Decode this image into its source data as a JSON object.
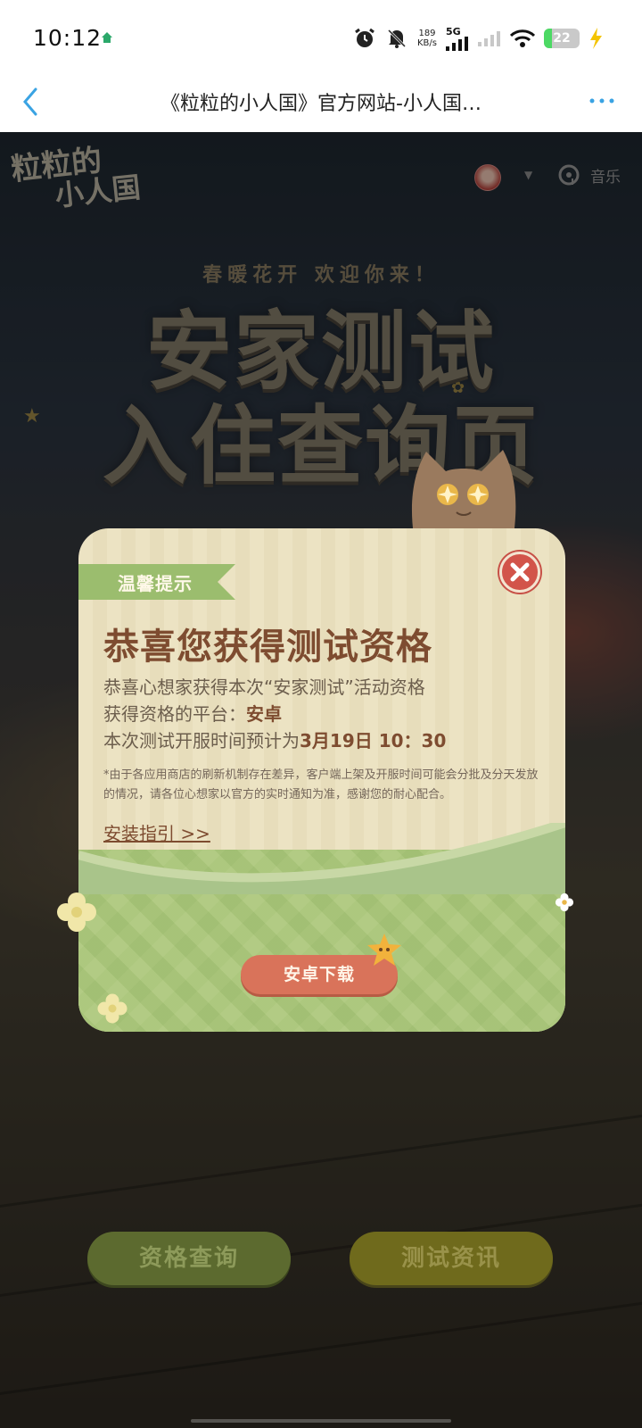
{
  "status_bar": {
    "time": "10:12",
    "net_speed_value": "189",
    "net_speed_unit": "KB/s",
    "network_type": "5G",
    "battery_level": "22"
  },
  "browser": {
    "page_title": "《粒粒的小人国》官方网站-小人国…"
  },
  "game": {
    "logo_line1": "粒粒的",
    "logo_line2": "小人国",
    "music_label": "音乐",
    "headline_sub": "春暖花开 欢迎你来！",
    "headline_line1": "安家测试",
    "headline_line2": "入住查询页"
  },
  "dialog": {
    "tag": "温馨提示",
    "heading": "恭喜您获得测试资格",
    "line1": "恭喜心想家获得本次“安家测试”活动资格",
    "platform_label": "获得资格的平台：",
    "platform_value": "安卓",
    "open_time_label": "本次测试开服时间预计为",
    "open_time_value": "3月19日 10：30",
    "note": "*由于各应用商店的刷新机制存在差异，客户端上架及开服时间可能会分批及分天发放的情况，请各位心想家以官方的实时通知为准，感谢您的耐心配合。",
    "install_guide": "安装指引 >>",
    "download_button": "安卓下载"
  },
  "bottom_buttons": {
    "check": "资格查询",
    "news": "测试资讯"
  },
  "colors": {
    "dialog_bg": "#ece3c3",
    "heading_brown": "#7e4c30",
    "tag_green": "#9bbd6e",
    "close_red": "#d2544a",
    "download_orange": "#d9735a",
    "browser_accent": "#3aa3e3"
  },
  "icons": {
    "back": "chevron-left-icon",
    "more": "more-dots-icon",
    "close": "close-icon",
    "music": "music-icon",
    "alarm": "alarm-icon",
    "mute": "bell-off-icon",
    "wifi": "wifi-icon",
    "signal": "signal-icon",
    "charging": "lightning-icon"
  }
}
